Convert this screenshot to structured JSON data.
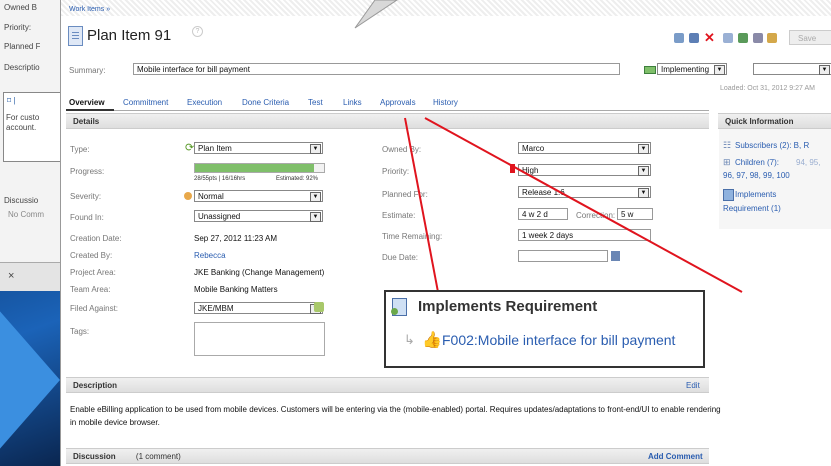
{
  "back_window": {
    "owned_label": "Owned B",
    "priority_label": "Priority:",
    "planned_label": "Planned F",
    "description_label": "Descriptio",
    "desc_text_1": "For custo",
    "desc_text_2": "account.",
    "discussion_label": "Discussio",
    "no_comments": "No Comm",
    "close_glyph": "×"
  },
  "breadcrumb": "Work Items »",
  "title": "Plan Item 91",
  "help_glyph": "?",
  "save_label": "Save",
  "summary_label": "Summary:",
  "summary_value": "Mobile interface for bill payment",
  "state_value": "Implementing",
  "loaded_text": "Loaded: Oct 31, 2012 9:27 AM",
  "tabs": [
    {
      "label": "Overview"
    },
    {
      "label": "Commitment"
    },
    {
      "label": "Execution"
    },
    {
      "label": "Done Criteria"
    },
    {
      "label": "Test"
    },
    {
      "label": "Links"
    },
    {
      "label": "Approvals"
    },
    {
      "label": "History"
    }
  ],
  "details_header": "Details",
  "left_fields": {
    "type_label": "Type:",
    "type_value": "Plan Item",
    "progress_label": "Progress:",
    "progress_fraction": 0.92,
    "progress_text": "28/55pts | 16/16hrs",
    "progress_estimated": "Estimated: 92%",
    "severity_label": "Severity:",
    "severity_value": "Normal",
    "found_in_label": "Found In:",
    "found_in_value": "Unassigned",
    "creation_date_label": "Creation Date:",
    "creation_date_value": "Sep 27, 2012 11:23 AM",
    "created_by_label": "Created By:",
    "created_by_value": "Rebecca",
    "project_area_label": "Project Area:",
    "project_area_value": "JKE Banking (Change Management)",
    "team_area_label": "Team Area:",
    "team_area_value": "Mobile Banking Matters",
    "filed_against_label": "Filed Against:",
    "filed_against_value": "JKE/MBM",
    "tags_label": "Tags:"
  },
  "right_fields": {
    "owned_by_label": "Owned By:",
    "owned_by_value": "Marco",
    "priority_label": "Priority:",
    "priority_value": "High",
    "planned_for_label": "Planned For:",
    "planned_for_value": "Release 1.6",
    "estimate_label": "Estimate:",
    "estimate_value": "4 w 2 d",
    "correction_label": "Correction:",
    "correction_value": "5 w",
    "time_remaining_label": "Time Remaining:",
    "time_remaining_value": "1 week 2 days",
    "due_date_label": "Due Date:"
  },
  "quick_info": {
    "header": "Quick Information",
    "subscribers": "Subscribers (2): B, R",
    "children_label": "Children (7):",
    "children_dim": "94, 95,",
    "children_more": "96, 97, 98, 99, 100",
    "implements_line1": "Implements",
    "implements_line2": "Requirement (1)"
  },
  "popup": {
    "title": "Implements Requirement",
    "link": "F002:Mobile interface for bill payment"
  },
  "description": {
    "header": "Description",
    "edit_label": "Edit",
    "text_line1": "Enable eBilling application to be used from mobile devices. Customers will be entering via the (mobile-enabled) portal. Requires updates/adaptations to front-end/UI to enable rendering",
    "text_line2": "in mobile device browser."
  },
  "discussion": {
    "header": "Discussion",
    "count": "(1 comment)",
    "add_label": "Add Comment"
  },
  "colors": {
    "accent_red": "#e0141e",
    "link_blue": "#2a5db0",
    "progress_green": "#7fbf6a"
  }
}
